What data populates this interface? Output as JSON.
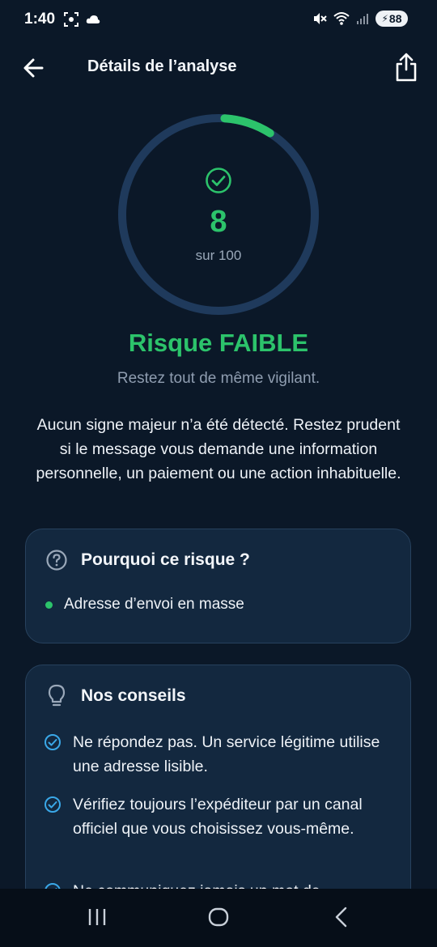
{
  "status_bar": {
    "time": "1:40",
    "battery": "88",
    "icons": [
      "screenshot-icon",
      "cloud-icon",
      "mute-icon",
      "wifi-icon",
      "signal-icon",
      "battery-icon"
    ]
  },
  "app_bar": {
    "title": "Détails de l’analyse",
    "back_icon": "arrow-left-icon",
    "share_icon": "share-icon"
  },
  "gauge": {
    "score": "8",
    "max_label": "sur 100",
    "score_fraction": 0.08,
    "color_active": "#2cc36b",
    "color_track": "#1f3a5c"
  },
  "risk": {
    "title": "Risque FAIBLE",
    "subtitle": "Restez tout de même vigilant.",
    "description": "Aucun signe majeur n’a été détecté. Restez prudent si le message vous demande une information personnelle, un paiement ou une action inhabituelle."
  },
  "why_card": {
    "title": "Pourquoi ce risque ?",
    "icon": "question-circle-icon",
    "items": [
      "Adresse d’envoi en masse"
    ]
  },
  "tips_card": {
    "title": "Nos conseils",
    "icon": "lightbulb-icon",
    "items": [
      "Ne répondez pas. Un service légitime utilise une adresse lisible.",
      "Vérifiez toujours l’expéditeur par un canal officiel que vous choisissez vous-même.",
      "Ne communiquez jamais un mot de"
    ]
  },
  "colors": {
    "background": "#0b1828",
    "card": "#13283f",
    "accent_green": "#2cc36b",
    "accent_blue": "#3aa8e8"
  },
  "nav_bar": {
    "icons": [
      "recents-icon",
      "home-icon",
      "back-nav-icon"
    ]
  }
}
